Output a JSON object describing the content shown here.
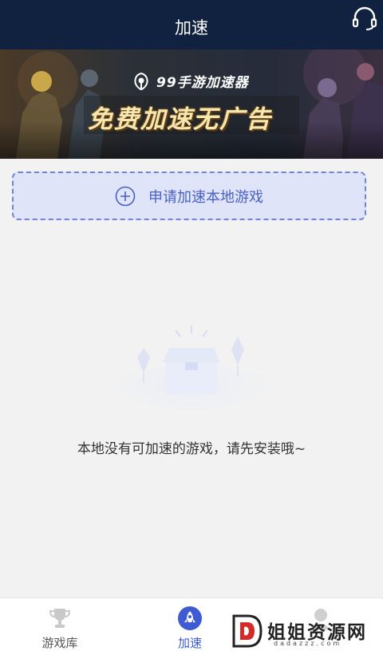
{
  "header": {
    "title": "加速",
    "headset_icon": "headset-icon"
  },
  "banner": {
    "brand_name": "99手游加速器",
    "slogan": "免费加速无广告",
    "logo_icon": "leaf-logo-icon"
  },
  "apply_button": {
    "label": "申请加速本地游戏",
    "icon": "plus-circle-icon"
  },
  "empty_state": {
    "message": "本地没有可加速的游戏，请先安装哦~",
    "illustration": "empty-box-illustration"
  },
  "tabbar": {
    "tabs": [
      {
        "label": "游戏库",
        "icon": "trophy-icon",
        "active": false
      },
      {
        "label": "加速",
        "icon": "rocket-icon",
        "active": true
      },
      {
        "label": "",
        "icon": "user-icon",
        "active": false
      }
    ]
  },
  "watermark": {
    "text": "姐姐资源网",
    "subtext": "dadazzz.com"
  },
  "colors": {
    "header_bg": "#10223f",
    "accent": "#3f5bd4",
    "apply_bg": "#dfe4f8",
    "page_bg": "#f2f2f2"
  }
}
